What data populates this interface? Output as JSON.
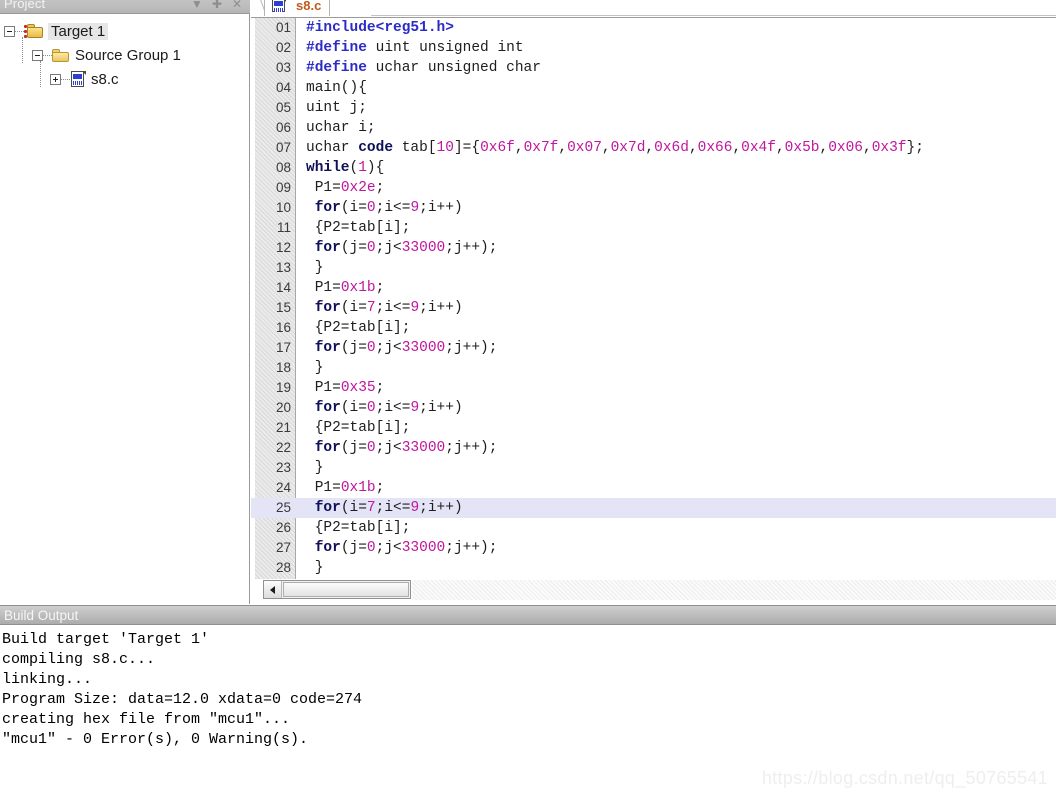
{
  "project_panel": {
    "title": "Project",
    "header_icons": [
      {
        "name": "chevron-down-icon",
        "glyph": "▼"
      },
      {
        "name": "pin-icon",
        "glyph": "✚"
      },
      {
        "name": "close-icon",
        "glyph": "✕"
      }
    ],
    "tree": [
      {
        "label": "Target 1",
        "level": 1,
        "icon": "target-folder-icon",
        "expander": "minus",
        "selected": true
      },
      {
        "label": "Source Group 1",
        "level": 2,
        "icon": "folder-icon",
        "expander": "minus",
        "selected": false
      },
      {
        "label": "s8.c",
        "level": 3,
        "icon": "c-file-icon",
        "expander": "plus",
        "selected": false
      }
    ]
  },
  "editor": {
    "tab_label": "s8.c",
    "tab_icon": "c-file-icon",
    "highlighted_line": 25,
    "scrollbar": {
      "left_arrow": "◀"
    },
    "lines": [
      {
        "n": "01",
        "tokens": [
          {
            "t": "#include<reg51.h>",
            "c": "t-pre"
          }
        ]
      },
      {
        "n": "02",
        "tokens": [
          {
            "t": "#define",
            "c": "t-pre"
          },
          {
            "t": " uint unsigned int",
            "c": "t-plain"
          }
        ]
      },
      {
        "n": "03",
        "tokens": [
          {
            "t": "#define",
            "c": "t-pre"
          },
          {
            "t": " uchar unsigned char",
            "c": "t-plain"
          }
        ]
      },
      {
        "n": "04",
        "tokens": [
          {
            "t": "main(){",
            "c": "t-plain"
          }
        ]
      },
      {
        "n": "05",
        "tokens": [
          {
            "t": "uint j;",
            "c": "t-plain"
          }
        ]
      },
      {
        "n": "06",
        "tokens": [
          {
            "t": "uchar i;",
            "c": "t-plain"
          }
        ]
      },
      {
        "n": "07",
        "tokens": [
          {
            "t": "uchar ",
            "c": "t-plain"
          },
          {
            "t": "code",
            "c": "t-kw"
          },
          {
            "t": " tab[",
            "c": "t-plain"
          },
          {
            "t": "10",
            "c": "t-num"
          },
          {
            "t": "]={",
            "c": "t-plain"
          },
          {
            "t": "0x6f",
            "c": "t-num"
          },
          {
            "t": ",",
            "c": "t-plain"
          },
          {
            "t": "0x7f",
            "c": "t-num"
          },
          {
            "t": ",",
            "c": "t-plain"
          },
          {
            "t": "0x07",
            "c": "t-num"
          },
          {
            "t": ",",
            "c": "t-plain"
          },
          {
            "t": "0x7d",
            "c": "t-num"
          },
          {
            "t": ",",
            "c": "t-plain"
          },
          {
            "t": "0x6d",
            "c": "t-num"
          },
          {
            "t": ",",
            "c": "t-plain"
          },
          {
            "t": "0x66",
            "c": "t-num"
          },
          {
            "t": ",",
            "c": "t-plain"
          },
          {
            "t": "0x4f",
            "c": "t-num"
          },
          {
            "t": ",",
            "c": "t-plain"
          },
          {
            "t": "0x5b",
            "c": "t-num"
          },
          {
            "t": ",",
            "c": "t-plain"
          },
          {
            "t": "0x06",
            "c": "t-num"
          },
          {
            "t": ",",
            "c": "t-plain"
          },
          {
            "t": "0x3f",
            "c": "t-num"
          },
          {
            "t": "};",
            "c": "t-plain"
          }
        ]
      },
      {
        "n": "08",
        "tokens": [
          {
            "t": "while",
            "c": "t-kw"
          },
          {
            "t": "(",
            "c": "t-plain"
          },
          {
            "t": "1",
            "c": "t-num"
          },
          {
            "t": "){",
            "c": "t-plain"
          }
        ]
      },
      {
        "n": "09",
        "tokens": [
          {
            "t": " P1=",
            "c": "t-plain"
          },
          {
            "t": "0x2e",
            "c": "t-num"
          },
          {
            "t": ";",
            "c": "t-plain"
          }
        ]
      },
      {
        "n": "10",
        "tokens": [
          {
            "t": " ",
            "c": "t-plain"
          },
          {
            "t": "for",
            "c": "t-kw"
          },
          {
            "t": "(i=",
            "c": "t-plain"
          },
          {
            "t": "0",
            "c": "t-num"
          },
          {
            "t": ";i<=",
            "c": "t-plain"
          },
          {
            "t": "9",
            "c": "t-num"
          },
          {
            "t": ";i++)",
            "c": "t-plain"
          }
        ]
      },
      {
        "n": "11",
        "tokens": [
          {
            "t": " {P2=tab[i];",
            "c": "t-plain"
          }
        ]
      },
      {
        "n": "12",
        "tokens": [
          {
            "t": " ",
            "c": "t-plain"
          },
          {
            "t": "for",
            "c": "t-kw"
          },
          {
            "t": "(j=",
            "c": "t-plain"
          },
          {
            "t": "0",
            "c": "t-num"
          },
          {
            "t": ";j<",
            "c": "t-plain"
          },
          {
            "t": "33000",
            "c": "t-num"
          },
          {
            "t": ";j++);",
            "c": "t-plain"
          }
        ]
      },
      {
        "n": "13",
        "tokens": [
          {
            "t": " }",
            "c": "t-plain"
          }
        ]
      },
      {
        "n": "14",
        "tokens": [
          {
            "t": " P1=",
            "c": "t-plain"
          },
          {
            "t": "0x1b",
            "c": "t-num"
          },
          {
            "t": ";",
            "c": "t-plain"
          }
        ]
      },
      {
        "n": "15",
        "tokens": [
          {
            "t": " ",
            "c": "t-plain"
          },
          {
            "t": "for",
            "c": "t-kw"
          },
          {
            "t": "(i=",
            "c": "t-plain"
          },
          {
            "t": "7",
            "c": "t-num"
          },
          {
            "t": ";i<=",
            "c": "t-plain"
          },
          {
            "t": "9",
            "c": "t-num"
          },
          {
            "t": ";i++)",
            "c": "t-plain"
          }
        ]
      },
      {
        "n": "16",
        "tokens": [
          {
            "t": " {P2=tab[i];",
            "c": "t-plain"
          }
        ]
      },
      {
        "n": "17",
        "tokens": [
          {
            "t": " ",
            "c": "t-plain"
          },
          {
            "t": "for",
            "c": "t-kw"
          },
          {
            "t": "(j=",
            "c": "t-plain"
          },
          {
            "t": "0",
            "c": "t-num"
          },
          {
            "t": ";j<",
            "c": "t-plain"
          },
          {
            "t": "33000",
            "c": "t-num"
          },
          {
            "t": ";j++);",
            "c": "t-plain"
          }
        ]
      },
      {
        "n": "18",
        "tokens": [
          {
            "t": " }",
            "c": "t-plain"
          }
        ]
      },
      {
        "n": "19",
        "tokens": [
          {
            "t": " P1=",
            "c": "t-plain"
          },
          {
            "t": "0x35",
            "c": "t-num"
          },
          {
            "t": ";",
            "c": "t-plain"
          }
        ]
      },
      {
        "n": "20",
        "tokens": [
          {
            "t": " ",
            "c": "t-plain"
          },
          {
            "t": "for",
            "c": "t-kw"
          },
          {
            "t": "(i=",
            "c": "t-plain"
          },
          {
            "t": "0",
            "c": "t-num"
          },
          {
            "t": ";i<=",
            "c": "t-plain"
          },
          {
            "t": "9",
            "c": "t-num"
          },
          {
            "t": ";i++)",
            "c": "t-plain"
          }
        ]
      },
      {
        "n": "21",
        "tokens": [
          {
            "t": " {P2=tab[i];",
            "c": "t-plain"
          }
        ]
      },
      {
        "n": "22",
        "tokens": [
          {
            "t": " ",
            "c": "t-plain"
          },
          {
            "t": "for",
            "c": "t-kw"
          },
          {
            "t": "(j=",
            "c": "t-plain"
          },
          {
            "t": "0",
            "c": "t-num"
          },
          {
            "t": ";j<",
            "c": "t-plain"
          },
          {
            "t": "33000",
            "c": "t-num"
          },
          {
            "t": ";j++);",
            "c": "t-plain"
          }
        ]
      },
      {
        "n": "23",
        "tokens": [
          {
            "t": " }",
            "c": "t-plain"
          }
        ]
      },
      {
        "n": "24",
        "tokens": [
          {
            "t": " P1=",
            "c": "t-plain"
          },
          {
            "t": "0x1b",
            "c": "t-num"
          },
          {
            "t": ";",
            "c": "t-plain"
          }
        ]
      },
      {
        "n": "25",
        "tokens": [
          {
            "t": " ",
            "c": "t-plain"
          },
          {
            "t": "for",
            "c": "t-kw"
          },
          {
            "t": "(i=",
            "c": "t-plain"
          },
          {
            "t": "7",
            "c": "t-num"
          },
          {
            "t": ";i<=",
            "c": "t-plain"
          },
          {
            "t": "9",
            "c": "t-num"
          },
          {
            "t": ";i++)",
            "c": "t-plain"
          }
        ]
      },
      {
        "n": "26",
        "tokens": [
          {
            "t": " {P2=tab[i];",
            "c": "t-plain"
          }
        ]
      },
      {
        "n": "27",
        "tokens": [
          {
            "t": " ",
            "c": "t-plain"
          },
          {
            "t": "for",
            "c": "t-kw"
          },
          {
            "t": "(j=",
            "c": "t-plain"
          },
          {
            "t": "0",
            "c": "t-num"
          },
          {
            "t": ";j<",
            "c": "t-plain"
          },
          {
            "t": "33000",
            "c": "t-num"
          },
          {
            "t": ";j++);",
            "c": "t-plain"
          }
        ]
      },
      {
        "n": "28",
        "tokens": [
          {
            "t": " }",
            "c": "t-plain"
          }
        ]
      }
    ]
  },
  "build_output": {
    "title": "Build Output",
    "lines": [
      "Build target 'Target 1'",
      "compiling s8.c...",
      "linking...",
      "Program Size: data=12.0 xdata=0 code=274",
      "creating hex file from \"mcu1\"...",
      "\"mcu1\" - 0 Error(s), 0 Warning(s)."
    ]
  },
  "watermark": "https://blog.csdn.net/qq_50765541",
  "colors": {
    "preprocessor": "#2b2bc8",
    "keyword": "#101058",
    "number": "#c0169c",
    "plain": "#1e1e1e",
    "highlight_line_bg": "#e4e4f7",
    "tab_label": "#c0581b",
    "panel_header_bg": "#bdbdbd"
  }
}
